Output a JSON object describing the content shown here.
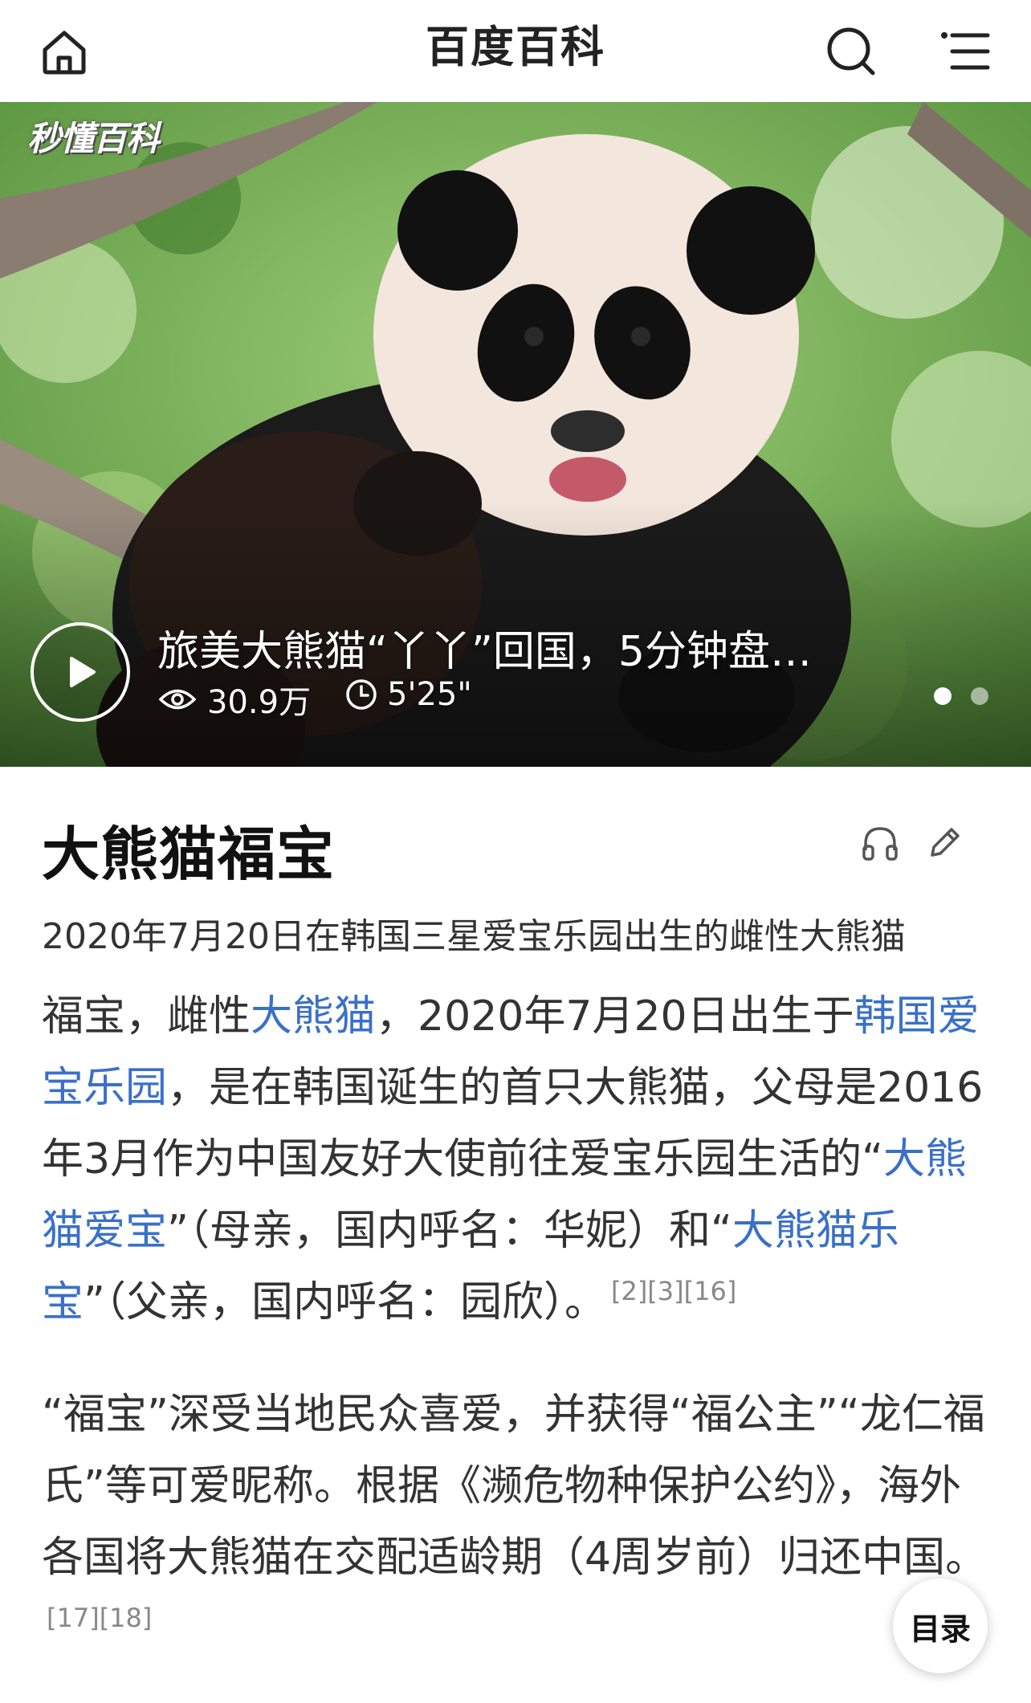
{
  "header": {
    "title": "百度百科",
    "icons": [
      "home-icon",
      "search-icon",
      "menu-icon"
    ]
  },
  "hero": {
    "watermark": "秒懂百科",
    "video_title": "旅美大熊猫“丫丫”回国，5分钟盘…",
    "views": "30.9万",
    "duration": "5'25\"",
    "carousel": {
      "count": 2,
      "active": 1
    }
  },
  "article": {
    "title": "大熊猫福宝",
    "subtitle": "2020年7月20日在韩国三星爱宝乐园出生的雌性大熊猫",
    "p1": {
      "t1": "福宝，雌性",
      "l1": "大熊猫",
      "t2": "，2020年7月20日出生于",
      "l2": "韩国爱宝乐园",
      "t3": "，是在韩国诞生的首只大熊猫，父母是2016年3月作为中国友好大使前往爱宝乐园生活的“",
      "l3": "大熊猫爱宝",
      "t4": "”（母亲，国内呼名：华妮）和“",
      "l4": "大熊猫乐宝",
      "t5": "”（父亲，国内呼名：园欣）。",
      "refs": "[2][3][16]"
    },
    "p2": {
      "text": "“福宝”深受当地民众喜爱，并获得“福公主”“龙仁福氏”等可爱昵称。根据《濒危物种保护公约》，海外各国将大熊猫在交配适龄期（4周岁前）归还中国。",
      "refs": "[17][18]"
    }
  },
  "toc_button": "目录",
  "colors": {
    "link": "#3a70c8",
    "text": "#333333",
    "title": "#111111"
  }
}
